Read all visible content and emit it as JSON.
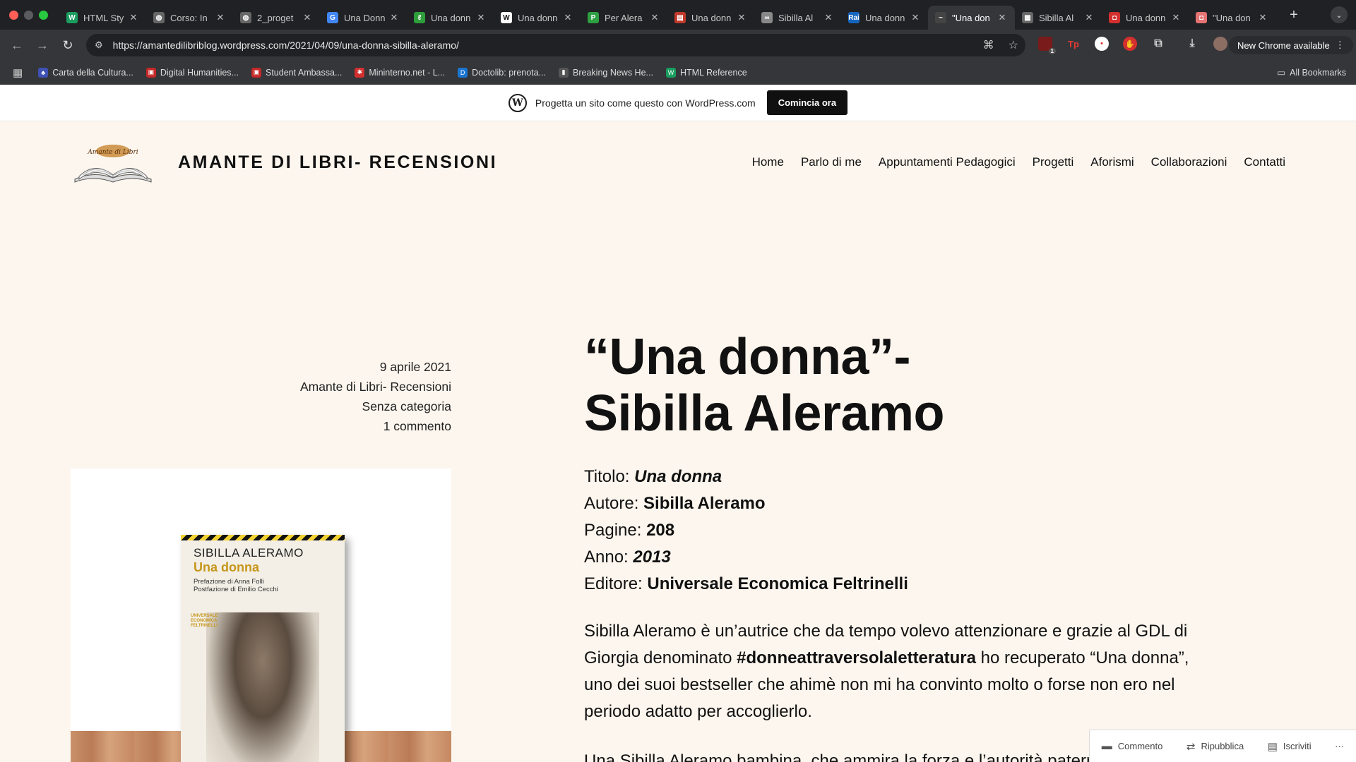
{
  "browser": {
    "tabs": [
      {
        "title": "HTML Sty",
        "icon": "w-green-icon",
        "color": "#1a9e5f",
        "glyph": "W"
      },
      {
        "title": "Corso: In",
        "icon": "globe-icon",
        "color": "#666666",
        "glyph": "◍"
      },
      {
        "title": "2_proget",
        "icon": "globe-icon",
        "color": "#666666",
        "glyph": "◍"
      },
      {
        "title": "Una Donn",
        "icon": "google-icon",
        "color": "#4285f4",
        "glyph": "G"
      },
      {
        "title": "Una donn",
        "icon": "leaf-icon",
        "color": "#2e9e3a",
        "glyph": "ℓ"
      },
      {
        "title": "Una donn",
        "icon": "wikipedia-icon",
        "color": "#ffffff",
        "glyph": "W"
      },
      {
        "title": "Per Alera",
        "icon": "green-circle-icon",
        "color": "#2ea043",
        "glyph": "P"
      },
      {
        "title": "Una donn",
        "icon": "book-icon",
        "color": "#c0392b",
        "glyph": "▤"
      },
      {
        "title": "Sibilla Al",
        "icon": "link-icon",
        "color": "#888888",
        "glyph": "∞"
      },
      {
        "title": "Una donn",
        "icon": "rai-icon",
        "color": "#1565c0",
        "glyph": "Rai"
      },
      {
        "title": "\"Una don",
        "icon": "blog-logo-icon",
        "color": "#444444",
        "glyph": "~",
        "active": true
      },
      {
        "title": "Sibilla Al",
        "icon": "newspaper-icon",
        "color": "#666666",
        "glyph": "▦"
      },
      {
        "title": "Una donn",
        "icon": "red-square-icon",
        "color": "#d32f2f",
        "glyph": "◘"
      },
      {
        "title": "\"Una don",
        "icon": "pink-square-icon",
        "color": "#e57373",
        "glyph": "◘"
      }
    ],
    "url": "https://amantedilibriblog.wordpress.com/2021/04/09/una-donna-sibilla-aleramo/",
    "update_label": "New Chrome available",
    "extension_badge": "1",
    "bookmarks": [
      {
        "label": "Carta della Cultura...",
        "color": "#3f51b5",
        "glyph": "♣"
      },
      {
        "label": "Digital Humanities...",
        "color": "#c62828",
        "glyph": "▣"
      },
      {
        "label": "Student Ambassa...",
        "color": "#c62828",
        "glyph": "▣"
      },
      {
        "label": "Mininterno.net - L...",
        "color": "#d32f2f",
        "glyph": "✱"
      },
      {
        "label": "Doctolib: prenota...",
        "color": "#1976d2",
        "glyph": "D"
      },
      {
        "label": "Breaking News He...",
        "color": "#555555",
        "glyph": "▮"
      },
      {
        "label": "HTML Reference",
        "color": "#1a9e5f",
        "glyph": "W"
      }
    ],
    "all_bookmarks_label": "All Bookmarks"
  },
  "wp_banner": {
    "text": "Progetta un sito come questo con WordPress.com",
    "cta": "Comincia ora"
  },
  "site": {
    "title": "AMANTE DI LIBRI- RECENSIONI",
    "nav": [
      "Home",
      "Parlo di me",
      "Appuntamenti Pedagogici",
      "Progetti",
      "Aforismi",
      "Collaborazioni",
      "Contatti"
    ]
  },
  "post": {
    "meta": {
      "date": "9 aprile 2021",
      "author": "Amante di Libri- Recensioni",
      "category": "Senza categoria",
      "comments": "1 commento"
    },
    "title_line1": "“Una donna”-",
    "title_line2": "Sibilla Aleramo",
    "facts": {
      "title_label": "Titolo: ",
      "title_value": "Una donna",
      "author_label": "Autore: ",
      "author_value": "Sibilla Aleramo",
      "pages_label": "Pagine: ",
      "pages_value": "208",
      "year_label": "Anno: ",
      "year_value": "2013",
      "publisher_label": "Editore: ",
      "publisher_value": "Universale Economica Feltrinelli"
    },
    "paragraph": {
      "part1": "Sibilla Aleramo è un’autrice che da tempo volevo attenzionare e grazie al GDL di Giorgia denominato ",
      "hashtag": "#donneattraversolaletteratura",
      "part2": " ho recuperato “Una donna”, uno dei suoi bestseller che ahimè non mi ha convinto molto o forse non ero nel periodo adatto per accoglierlo."
    },
    "paragraph2": "Una Sibilla Aleramo bambina, che ammira la forza e l’autorità paterna",
    "cover": {
      "author": "SIBILLA ALERAMO",
      "title": "Una donna",
      "preface1": "Prefazione di Anna Folli",
      "preface2": "Postfazione di Emilio Cecchi",
      "series": "UNIVERSALE ECONOMICA FELTRINELLI"
    }
  },
  "actions": {
    "comment": "Commento",
    "reblog": "Ripubblica",
    "subscribe": "Iscriviti",
    "more": "···"
  }
}
